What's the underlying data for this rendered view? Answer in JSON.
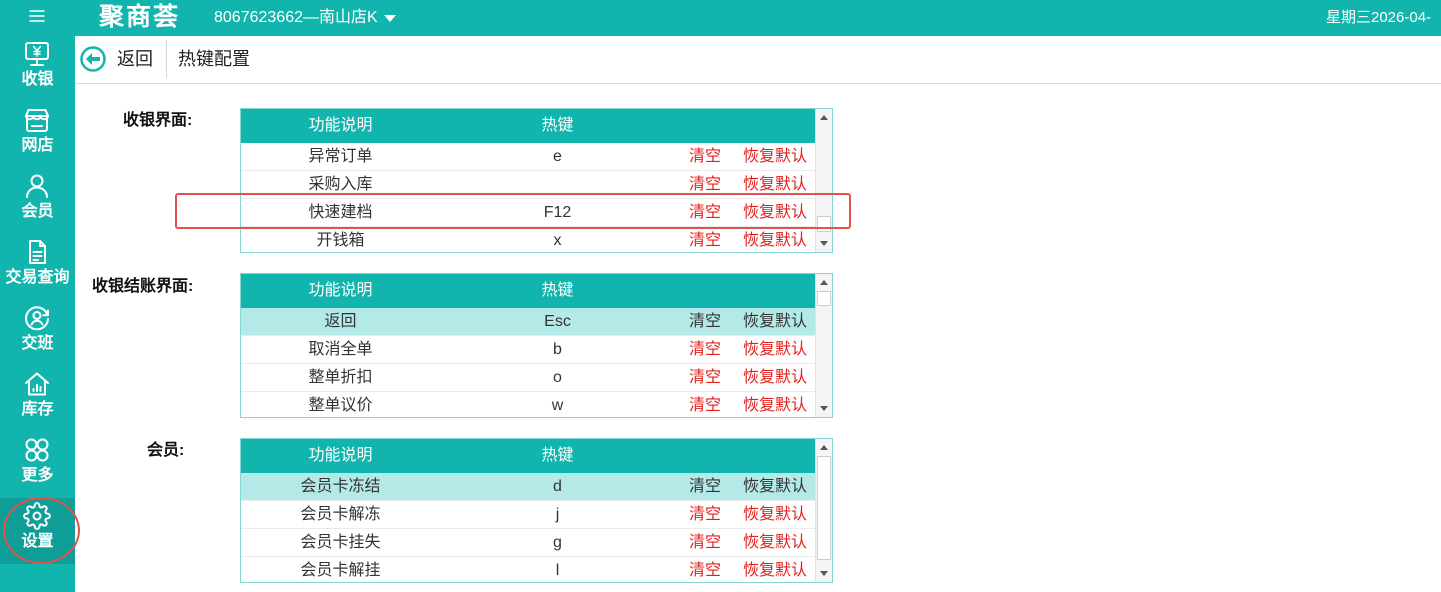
{
  "topbar": {
    "menu_icon": "hamburger-icon",
    "logo": "聚商荟",
    "store": "8067623662—南山店K",
    "store_caret_icon": "caret-down-icon",
    "date": "星期三2026-04-"
  },
  "sidebar": {
    "items": [
      {
        "label": "收银",
        "icon": "cashier-monitor-icon",
        "active": false
      },
      {
        "label": "网店",
        "icon": "online-store-icon",
        "active": false
      },
      {
        "label": "会员",
        "icon": "member-icon",
        "active": false
      },
      {
        "label": "交易查询",
        "icon": "transaction-document-icon",
        "active": false
      },
      {
        "label": "交班",
        "icon": "shift-handover-icon",
        "active": false
      },
      {
        "label": "库存",
        "icon": "inventory-house-icon",
        "active": false
      },
      {
        "label": "更多",
        "icon": "more-grid-icon",
        "active": false
      },
      {
        "label": "设置",
        "icon": "gear-icon",
        "active": true
      }
    ]
  },
  "header": {
    "back_icon": "back-arrow-circle-icon",
    "back_label": "返回",
    "title": "热键配置"
  },
  "columns": {
    "function": "功能说明",
    "hotkey": "热键"
  },
  "actions": {
    "clear": "清空",
    "restore": "恢复默认"
  },
  "sections": [
    {
      "label": "收银界面:",
      "rows": [
        {
          "function": "异常订单",
          "hotkey": "e"
        },
        {
          "function": "采购入库",
          "hotkey": ""
        },
        {
          "function": "快速建档",
          "hotkey": "F12"
        },
        {
          "function": "开钱箱",
          "hotkey": "x"
        }
      ]
    },
    {
      "label": "收银结账界面:",
      "rows": [
        {
          "function": "返回",
          "hotkey": "Esc",
          "selected": true
        },
        {
          "function": "取消全单",
          "hotkey": "b"
        },
        {
          "function": "整单折扣",
          "hotkey": "o"
        },
        {
          "function": "整单议价",
          "hotkey": "w"
        }
      ]
    },
    {
      "label": "会员:",
      "rows": [
        {
          "function": "会员卡冻结",
          "hotkey": "d",
          "selected": true
        },
        {
          "function": "会员卡解冻",
          "hotkey": "j"
        },
        {
          "function": "会员卡挂失",
          "hotkey": "g"
        },
        {
          "function": "会员卡解挂",
          "hotkey": "l"
        }
      ]
    }
  ],
  "colors": {
    "primary": "#12b5ad",
    "primary_dark": "#0e9e97",
    "row_selected": "#b3e9e6",
    "link": "#e3211d",
    "annotation": "#e2524c"
  }
}
